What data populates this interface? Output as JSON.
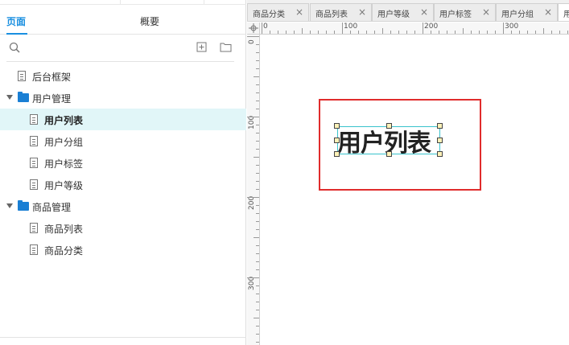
{
  "left_panel": {
    "tabs": [
      {
        "label": "页面"
      },
      {
        "label": "概要"
      }
    ],
    "tree": [
      {
        "label": "后台框架"
      },
      {
        "label": "用户管理"
      },
      {
        "label": "用户列表"
      },
      {
        "label": "用户分组"
      },
      {
        "label": "用户标签"
      },
      {
        "label": "用户等级"
      },
      {
        "label": "商品管理"
      },
      {
        "label": "商品列表"
      },
      {
        "label": "商品分类"
      }
    ],
    "selected_item": "用户列表"
  },
  "doc_tabs": [
    {
      "label": "商品分类"
    },
    {
      "label": "商品列表"
    },
    {
      "label": "用户等级"
    },
    {
      "label": "用户标签"
    },
    {
      "label": "用户分组"
    },
    {
      "label": "用"
    }
  ],
  "rulers": {
    "horizontal": [
      "0",
      "100",
      "200",
      "300"
    ],
    "vertical": [
      "0",
      "100",
      "200",
      "300"
    ]
  },
  "canvas": {
    "text": "用户列表",
    "frame_color": "#e02c2c",
    "selection_color": "#39c3cc"
  },
  "icons": {
    "search": "search-icon",
    "add_page": "add-page-icon",
    "add_folder": "add-folder-icon",
    "close": "close-icon"
  },
  "colors": {
    "accent": "#1a8fe0",
    "selected_row": "#e1f6f8"
  }
}
